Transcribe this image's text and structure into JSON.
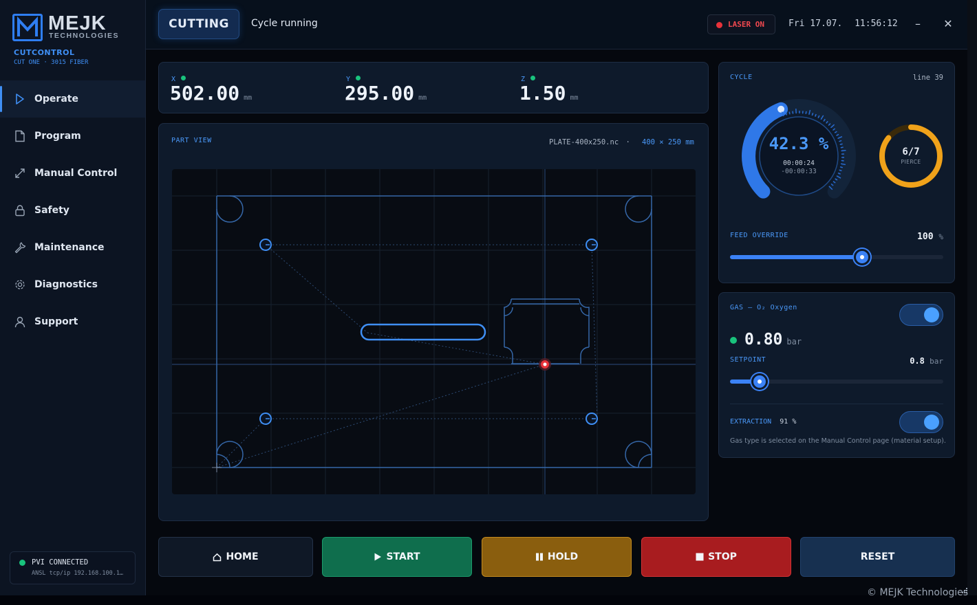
{
  "brand": {
    "name": "MEJK",
    "tagline": "TECHNOLOGIES",
    "app": "CUTCONTROL",
    "machine": "CUT ONE · 3015 FIBER"
  },
  "nav": {
    "items": [
      {
        "label": "Operate",
        "icon": "play-icon",
        "active": true
      },
      {
        "label": "Program",
        "icon": "file-icon"
      },
      {
        "label": "Manual Control",
        "icon": "move-diagonal-icon"
      },
      {
        "label": "Safety",
        "icon": "lock-icon"
      },
      {
        "label": "Maintenance",
        "icon": "wrench-icon"
      },
      {
        "label": "Diagnostics",
        "icon": "gear-icon"
      },
      {
        "label": "Support",
        "icon": "user-icon"
      }
    ]
  },
  "connection": {
    "status": "PVI CONNECTED",
    "address": "ANSL tcp/ip 192.168.100.1…",
    "color": "#19c37d"
  },
  "header": {
    "state": "CUTTING",
    "state_text": "Cycle running",
    "laser": "LASER ON",
    "laser_color": "#e8323a",
    "date": "Fri 17.07.",
    "time": "11:56:12",
    "minimize": "–",
    "close": "✕"
  },
  "axes": [
    {
      "name": "X",
      "value": "502.00",
      "unit": "mm"
    },
    {
      "name": "Y",
      "value": "295.00",
      "unit": "mm"
    },
    {
      "name": "Z",
      "value": "1.50",
      "unit": "mm"
    }
  ],
  "part_view": {
    "title": "PART VIEW",
    "file": "PLATE-400x250.nc",
    "separator": "·",
    "dims": "400 × 250 mm"
  },
  "cycle": {
    "title": "CYCLE",
    "line": "line 39",
    "progress": 42.3,
    "progress_text": "42.3 %",
    "elapsed": "00:00:24",
    "remaining": "-00:00:33",
    "pierce_done": 6,
    "pierce_total": 7,
    "pierce_text": "6/7",
    "pierce_label": "PIERCE",
    "accent": "#3b82f6",
    "pierce_color": "#f0a21a"
  },
  "feed": {
    "label": "FEED OVERRIDE",
    "value": "100",
    "unit": "%",
    "level": 0.62
  },
  "gas": {
    "title": "GAS – O₂ Oxygen",
    "enabled": true,
    "pressure": "0.80",
    "pressure_unit": "bar",
    "setpoint_label": "SETPOINT",
    "setpoint_value": "0.8",
    "setpoint_unit": "bar",
    "setpoint_level": 0.14,
    "extraction_label": "EXTRACTION",
    "extraction_value": "91",
    "extraction_unit": "%",
    "extraction_enabled": true,
    "note": "Gas type is selected on the Manual Control page (material setup)."
  },
  "actions": {
    "home": "HOME",
    "start": "START",
    "hold": "HOLD",
    "stop": "STOP",
    "reset": "RESET"
  },
  "footer": {
    "copyright": "© MEJK Technologies"
  }
}
